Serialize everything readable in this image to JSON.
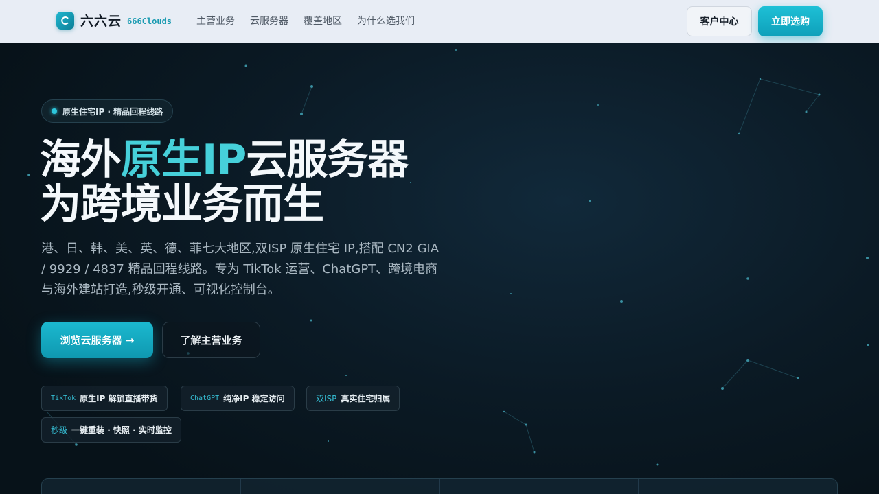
{
  "nav": {
    "brand_cn": "六六云",
    "brand_en": "666Clouds",
    "links": [
      {
        "label": "主营业务"
      },
      {
        "label": "云服务器"
      },
      {
        "label": "覆盖地区"
      },
      {
        "label": "为什么选我们"
      }
    ],
    "console_label": "客户中心",
    "buy_label": "立即选购"
  },
  "hero": {
    "eyebrow": "原生住宅IP · 精品回程线路",
    "headline": {
      "line1_pre": "海外",
      "line1_accent": "原生IP",
      "line1_post": "云服务器",
      "line2": "为跨境业务而生"
    },
    "subtitle": "港、日、韩、美、英、德、菲七大地区,双ISP 原生住宅 IP,搭配 CN2 GIA / 9929 / 4837 精品回程线路。专为 TikTok 运营、ChatGPT、跨境电商与海外建站打造,秒级开通、可视化控制台。",
    "cta_primary": "浏览云服务器 →",
    "cta_secondary": "了解主营业务",
    "chips": [
      {
        "tag": "TikTok",
        "text": "原生IP 解锁直播带货"
      },
      {
        "tag": "ChatGPT",
        "text": "纯净IP 稳定访问"
      },
      {
        "tag": "双ISP",
        "text": "真实住宅归属"
      },
      {
        "tag": "秒级",
        "text": "一键重装 · 快照 · 实时监控"
      }
    ]
  },
  "colors": {
    "accent": "#1bb9d0",
    "headline_accent": "#46d0da",
    "hero_bg": "#0b1a25",
    "nav_bg": "#e8edf5"
  },
  "icons": {
    "logo": "cloud-c-logo-icon",
    "eyebrow": "status-dot-icon"
  }
}
